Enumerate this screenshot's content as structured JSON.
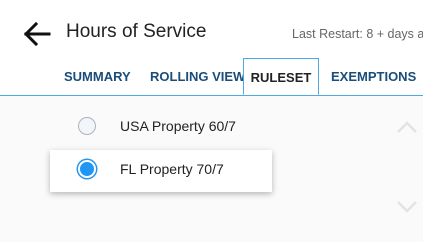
{
  "header": {
    "title": "Hours of Service",
    "restart_text": "Last Restart: 8 + days ago"
  },
  "tabs": [
    {
      "label": "SUMMARY",
      "active": false
    },
    {
      "label": "ROLLING VIEW",
      "active": false
    },
    {
      "label": "RULESET",
      "active": true
    },
    {
      "label": "EXEMPTIONS",
      "active": false
    }
  ],
  "ruleset": {
    "options": [
      {
        "label": "USA Property 60/7",
        "selected": false
      },
      {
        "label": "FL Property 70/7",
        "selected": true
      }
    ]
  },
  "icons": {
    "back": "arrow-left-icon",
    "scroll_up": "chevron-up-icon",
    "scroll_down": "chevron-down-icon"
  },
  "colors": {
    "accent": "#2196f3",
    "tab_text": "#1a4d7a",
    "tab_border": "#4fa9e0"
  }
}
